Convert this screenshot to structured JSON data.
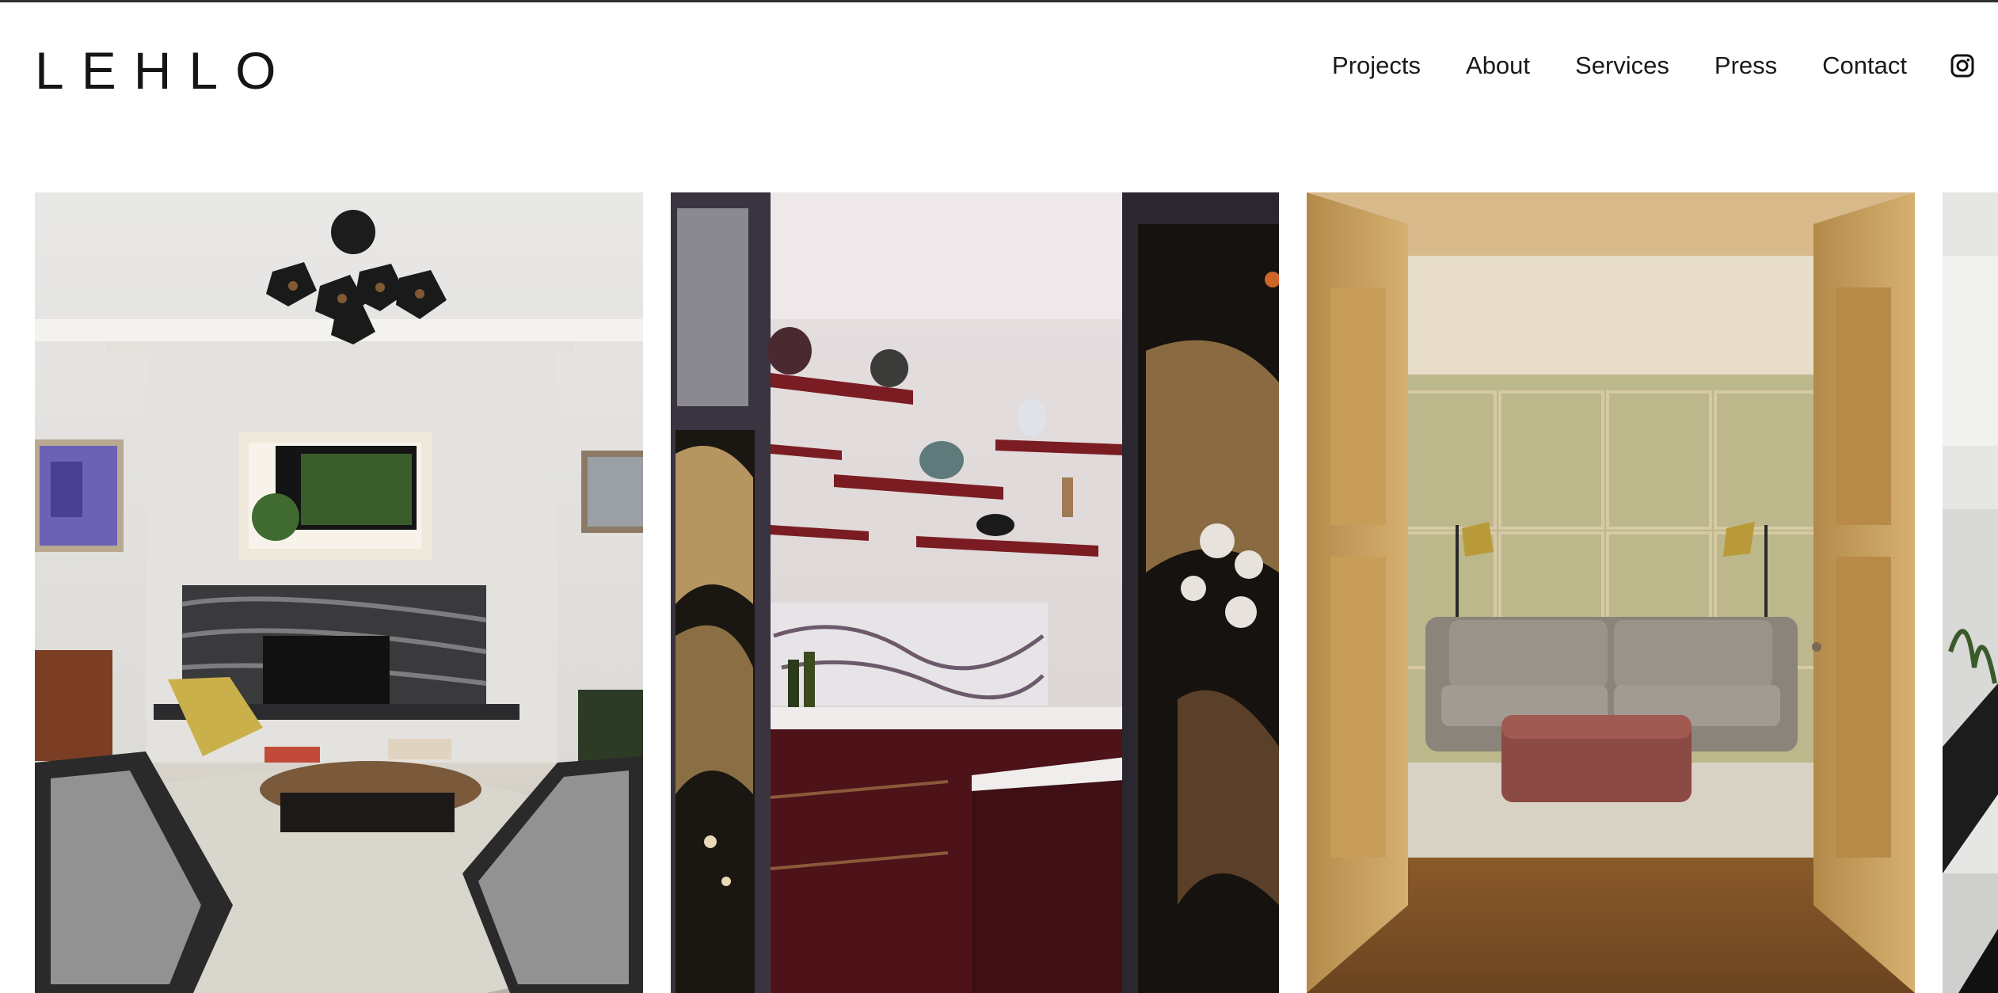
{
  "brand": {
    "logo_text": "LEHLO"
  },
  "nav": {
    "items": [
      {
        "label": "Projects"
      },
      {
        "label": "About"
      },
      {
        "label": "Services"
      },
      {
        "label": "Press"
      },
      {
        "label": "Contact"
      }
    ],
    "instagram_icon": "instagram-icon"
  },
  "gallery": {
    "tiles": [
      {
        "subject": "living room with fireplace"
      },
      {
        "subject": "kitchen with red shelves and chinoiserie panels"
      },
      {
        "subject": "sitting room seen through open wooden doors"
      },
      {
        "subject": "partial room image"
      }
    ]
  },
  "colors": {
    "text": "#1a1a1a",
    "background": "#ffffff",
    "top_rule": "#2f2f2f"
  }
}
